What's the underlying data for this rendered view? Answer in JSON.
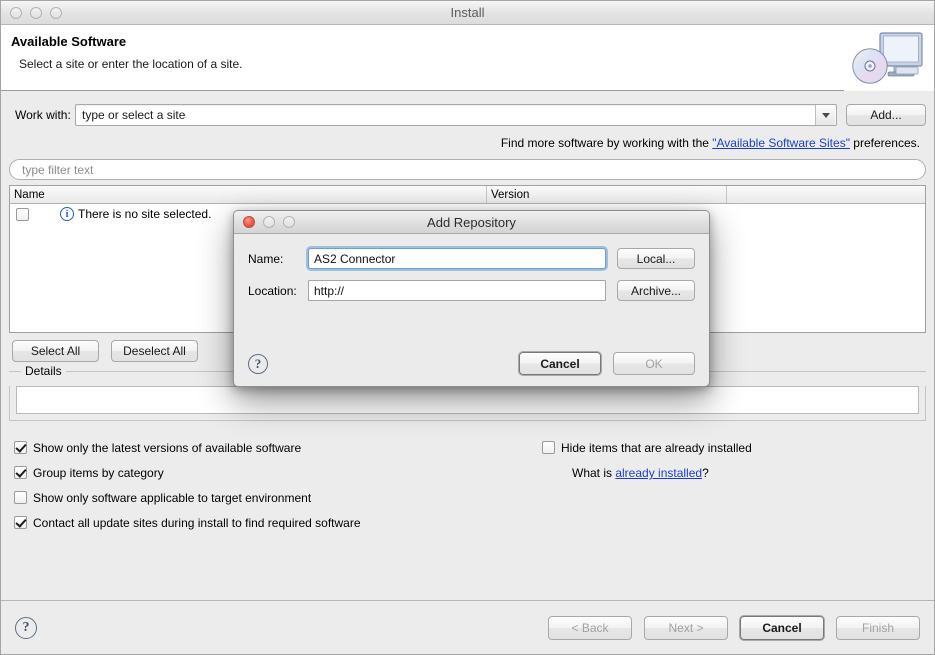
{
  "window": {
    "title": "Install",
    "traffic_lights": [
      "close",
      "minimize",
      "zoom"
    ],
    "active": false
  },
  "header": {
    "title": "Available Software",
    "subtitle": "Select a site or enter the location of a site.",
    "banner_icon": "monitor-with-disc-icon"
  },
  "work_with": {
    "label": "Work with:",
    "value": "type or select a site",
    "placeholder": "type or select a site",
    "dropdown_icon": "chevron-down-icon",
    "add_button": "Add..."
  },
  "find_more": {
    "prefix": "Find more software by working with the ",
    "link": "\"Available Software Sites\"",
    "suffix": " preferences."
  },
  "filter": {
    "placeholder": "type filter text",
    "value": ""
  },
  "table": {
    "columns": [
      "Name",
      "Version",
      ""
    ],
    "rows": [
      {
        "checked": false,
        "icon": "info-icon",
        "name": "There is no site selected.",
        "version": ""
      }
    ]
  },
  "selection_buttons": {
    "select_all": "Select All",
    "deselect_all": "Deselect All"
  },
  "details": {
    "label": "Details",
    "content": ""
  },
  "options": {
    "left": [
      {
        "label": "Show only the latest versions of available software",
        "checked": true
      },
      {
        "label": "Group items by category",
        "checked": true
      },
      {
        "label": "Show only software applicable to target environment",
        "checked": false
      },
      {
        "label": "Contact all update sites during install to find required software",
        "checked": true
      }
    ],
    "right": [
      {
        "label": "Hide items that are already installed",
        "checked": false
      }
    ],
    "what_is": {
      "prefix": "What is ",
      "link": "already installed",
      "suffix": "?"
    }
  },
  "footer": {
    "help_icon": "question-mark-icon",
    "buttons": [
      {
        "label": "< Back",
        "enabled": false,
        "default": false
      },
      {
        "label": "Next >",
        "enabled": false,
        "default": false
      },
      {
        "label": "Cancel",
        "enabled": true,
        "default": true
      },
      {
        "label": "Finish",
        "enabled": false,
        "default": false
      }
    ]
  },
  "modal": {
    "title": "Add Repository",
    "traffic_lights": [
      "close",
      "minimize",
      "zoom"
    ],
    "name": {
      "label": "Name:",
      "value": "AS2 Connector",
      "focused": true,
      "button": "Local..."
    },
    "location": {
      "label": "Location:",
      "value": "http://",
      "focused": false,
      "button": "Archive..."
    },
    "help_icon": "question-mark-icon",
    "buttons": [
      {
        "label": "Cancel",
        "enabled": true
      },
      {
        "label": "OK",
        "enabled": false
      }
    ]
  },
  "colors": {
    "link": "#1a3fd0",
    "window_bg": "#ececec",
    "header_bg": "#ffffff",
    "focus_ring": "#76a8dc",
    "info_icon": "#1f62c4",
    "close_red": "#f26152"
  }
}
